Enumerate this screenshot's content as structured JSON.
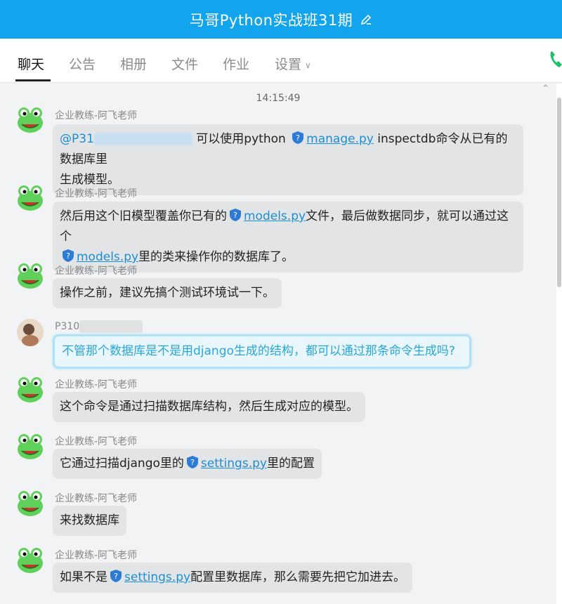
{
  "titlebar": {
    "title": "马哥Python实战班31期"
  },
  "tabs": [
    {
      "label": "聊天"
    },
    {
      "label": "公告"
    },
    {
      "label": "相册"
    },
    {
      "label": "文件"
    },
    {
      "label": "作业"
    },
    {
      "label": "设置"
    }
  ],
  "chat": {
    "timestamp": "14:15:49",
    "messages": [
      {
        "sender": "企业教练-阿飞老师",
        "mention": "@P31",
        "text_a": "可以使用python",
        "link": "manage.py",
        "text_b": "inspectdb命令从已有的数据库里",
        "text_c": "生成模型。"
      },
      {
        "sender": "企业教练-阿飞老师",
        "text_a": "然后用这个旧模型覆盖你已有的",
        "link_a": "models.py",
        "text_b": "文件，最后做数据同步，就可以通过这个",
        "link_b": "models.py",
        "text_c": "里的类来操作你的数据库了。"
      },
      {
        "sender": "企业教练-阿飞老师",
        "text": "操作之前，建议先搞个测试环境试一下。"
      },
      {
        "sender": "P310",
        "text": "不管那个数据库是不是用django生成的结构，都可以通过那条命令生成吗?"
      },
      {
        "sender": "企业教练-阿飞老师",
        "text": "这个命令是通过扫描数据库结构，然后生成对应的模型。"
      },
      {
        "sender": "企业教练-阿飞老师",
        "text_a": "它通过扫描django里的",
        "link": "settings.py",
        "text_b": "里的配置"
      },
      {
        "sender": "企业教练-阿飞老师",
        "text": "来找数据库"
      },
      {
        "sender": "企业教练-阿飞老师",
        "text_a": "如果不是",
        "link": "settings.py",
        "text_b": "配置里数据库，那么需要先把它加进去。"
      }
    ]
  },
  "colors": {
    "titlebar": "#12a5ee",
    "link": "#1a8fd6",
    "bubble": "#e3e4e6",
    "highlight_border": "#aee2f7"
  },
  "icons": [
    "edit-icon",
    "phone-icon",
    "frog-avatar",
    "user-avatar",
    "shield-icon",
    "collapse-icon"
  ]
}
